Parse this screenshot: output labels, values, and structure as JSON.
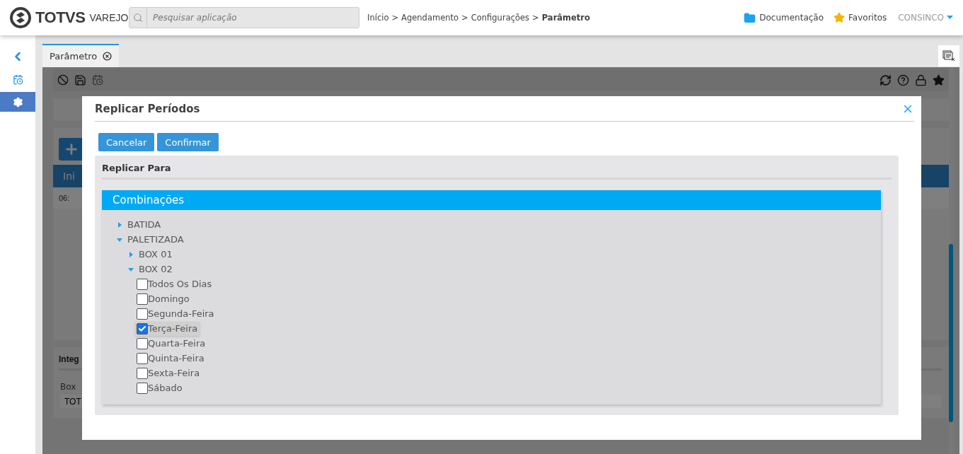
{
  "header": {
    "logo": "TOTVS",
    "logo_suffix": "VAREJO",
    "search": {
      "placeholder": "Pesquisar aplicação"
    },
    "breadcrumb": [
      {
        "kind": "link",
        "label": "Início"
      },
      {
        "kind": "separator",
        "label": ">"
      },
      {
        "kind": "link",
        "label": "Agendamento"
      },
      {
        "kind": "separator",
        "label": ">"
      },
      {
        "kind": "link",
        "label": "Configurações"
      },
      {
        "kind": "separator",
        "label": ">"
      },
      {
        "kind": "current",
        "label": "Parâmetro"
      }
    ],
    "links": [
      {
        "kind": "docs",
        "label": "Documentação"
      },
      {
        "kind": "favorites",
        "label": "Favoritos"
      }
    ],
    "user": {
      "label": "CONSINCO"
    }
  },
  "sidebar": {
    "items": [
      {
        "kind": "calendar",
        "selected": false
      },
      {
        "kind": "settings",
        "selected": true
      }
    ]
  },
  "tabs": [
    {
      "label": "Parâmetro",
      "selected": true
    }
  ],
  "background": {
    "table_header": "Ini",
    "table_cell": "06:",
    "card_title": "Integ",
    "field_label": "Box",
    "field_value": "TOT"
  },
  "modal": {
    "title": "Replicar Períodos",
    "buttons": [
      "Cancelar",
      "Confirmar"
    ],
    "section_title": "Replicar Para",
    "tree_title": "Combinações",
    "tree": [
      {
        "label": "BATIDA",
        "kind": "branch",
        "expanded": false
      },
      {
        "label": "PALETIZADA",
        "kind": "branch",
        "expanded": true,
        "children": [
          {
            "label": "BOX 01",
            "kind": "branch",
            "expanded": false
          },
          {
            "label": "BOX 02",
            "kind": "branch",
            "expanded": true,
            "children": [
              {
                "label": "Todos Os Dias",
                "kind": "checkbox",
                "checked": false,
                "selected": false
              },
              {
                "label": "Domingo",
                "kind": "checkbox",
                "checked": false,
                "selected": false
              },
              {
                "label": "Segunda-Feira",
                "kind": "checkbox",
                "checked": false,
                "selected": false
              },
              {
                "label": "Terça-Feira",
                "kind": "checkbox",
                "checked": true,
                "selected": true
              },
              {
                "label": "Quarta-Feira",
                "kind": "checkbox",
                "checked": false,
                "selected": false
              },
              {
                "label": "Quinta-Feira",
                "kind": "checkbox",
                "checked": false,
                "selected": false
              },
              {
                "label": "Sexta-Feira",
                "kind": "checkbox",
                "checked": false,
                "selected": false
              },
              {
                "label": "Sábado",
                "kind": "checkbox",
                "checked": false,
                "selected": false
              }
            ]
          }
        ]
      }
    ]
  }
}
